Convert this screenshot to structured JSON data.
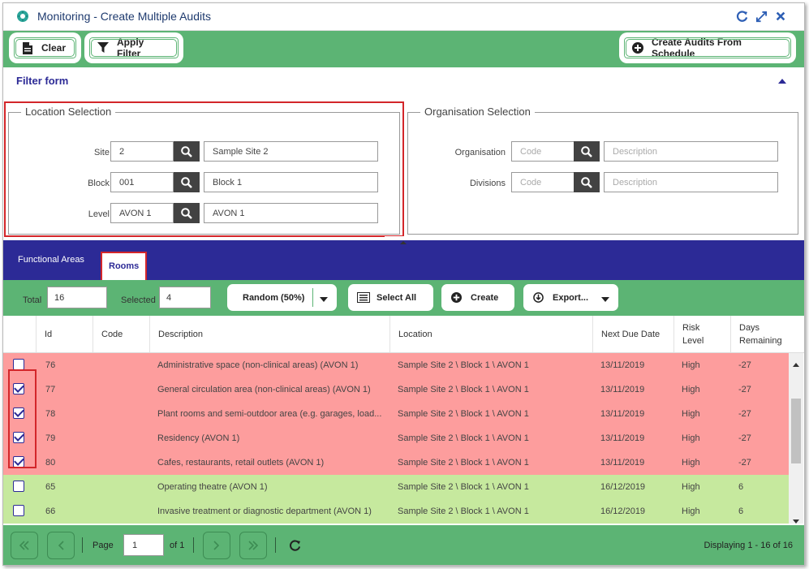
{
  "window": {
    "title": "Monitoring - Create Multiple Audits"
  },
  "toolbar": {
    "clear_label": "Clear",
    "apply_filter_label": "Apply Filter",
    "create_from_schedule_label": "Create Audits From Schedule"
  },
  "filter_form": {
    "title": "Filter form",
    "location": {
      "legend": "Location Selection",
      "site": {
        "label": "Site",
        "code": "2",
        "description": "Sample Site 2"
      },
      "block": {
        "label": "Block",
        "code": "001",
        "description": "Block 1"
      },
      "level": {
        "label": "Level",
        "code": "AVON 1",
        "description": "AVON 1"
      }
    },
    "organisation": {
      "legend": "Organisation Selection",
      "organisation": {
        "label": "Organisation",
        "code_placeholder": "Code",
        "description_placeholder": "Description"
      },
      "divisions": {
        "label": "Divisions",
        "code_placeholder": "Code",
        "description_placeholder": "Description"
      }
    }
  },
  "tabs": [
    {
      "label": "Functional Areas",
      "active": false
    },
    {
      "label": "Rooms",
      "active": true
    }
  ],
  "grid_toolbar": {
    "total_label": "Total",
    "total_value": "16",
    "selected_label": "Selected",
    "selected_value": "4",
    "random_label": "Random (50%)",
    "select_all_label": "Select All",
    "create_label": "Create",
    "export_label": "Export..."
  },
  "grid": {
    "columns": {
      "id": "Id",
      "code": "Code",
      "description": "Description",
      "location": "Location",
      "next_due": "Next Due Date",
      "risk_1": "Risk",
      "risk_2": "Level",
      "days_1": "Days",
      "days_2": "Remaining"
    },
    "rows": [
      {
        "id": "76",
        "code": "",
        "description": "Administrative space (non-clinical areas) (AVON 1)",
        "location": "Sample Site 2 \\ Block 1 \\ AVON 1",
        "next_due": "13/11/2019",
        "risk": "High",
        "days": "-27",
        "checked": false,
        "status": "red"
      },
      {
        "id": "77",
        "code": "",
        "description": "General circulation area (non-clinical areas) (AVON 1)",
        "location": "Sample Site 2 \\ Block 1 \\ AVON 1",
        "next_due": "13/11/2019",
        "risk": "High",
        "days": "-27",
        "checked": true,
        "status": "red"
      },
      {
        "id": "78",
        "code": "",
        "description": "Plant rooms and semi-outdoor area (e.g. garages, load...",
        "location": "Sample Site 2 \\ Block 1 \\ AVON 1",
        "next_due": "13/11/2019",
        "risk": "High",
        "days": "-27",
        "checked": true,
        "status": "red"
      },
      {
        "id": "79",
        "code": "",
        "description": "Residency (AVON 1)",
        "location": "Sample Site 2 \\ Block 1 \\ AVON 1",
        "next_due": "13/11/2019",
        "risk": "High",
        "days": "-27",
        "checked": true,
        "status": "red"
      },
      {
        "id": "80",
        "code": "",
        "description": "Cafes, restaurants, retail outlets (AVON 1)",
        "location": "Sample Site 2 \\ Block 1 \\ AVON 1",
        "next_due": "13/11/2019",
        "risk": "High",
        "days": "-27",
        "checked": true,
        "status": "red"
      },
      {
        "id": "65",
        "code": "",
        "description": "Operating theatre (AVON 1)",
        "location": "Sample Site 2 \\ Block 1 \\ AVON 1",
        "next_due": "16/12/2019",
        "risk": "High",
        "days": "6",
        "checked": false,
        "status": "green"
      },
      {
        "id": "66",
        "code": "",
        "description": "Invasive treatment or diagnostic department (AVON 1)",
        "location": "Sample Site 2 \\ Block 1 \\ AVON 1",
        "next_due": "16/12/2019",
        "risk": "High",
        "days": "6",
        "checked": false,
        "status": "green"
      }
    ]
  },
  "pager": {
    "page_label": "Page",
    "page_value": "1",
    "of_label": "of 1",
    "displaying": "Displaying 1 - 16 of 16"
  },
  "colors": {
    "green_bar": "#5cb474",
    "navy": "#2c2a96",
    "overdue_row": "#fd9d9d",
    "ok_row": "#c6e99e",
    "highlight": "#d3262a"
  }
}
